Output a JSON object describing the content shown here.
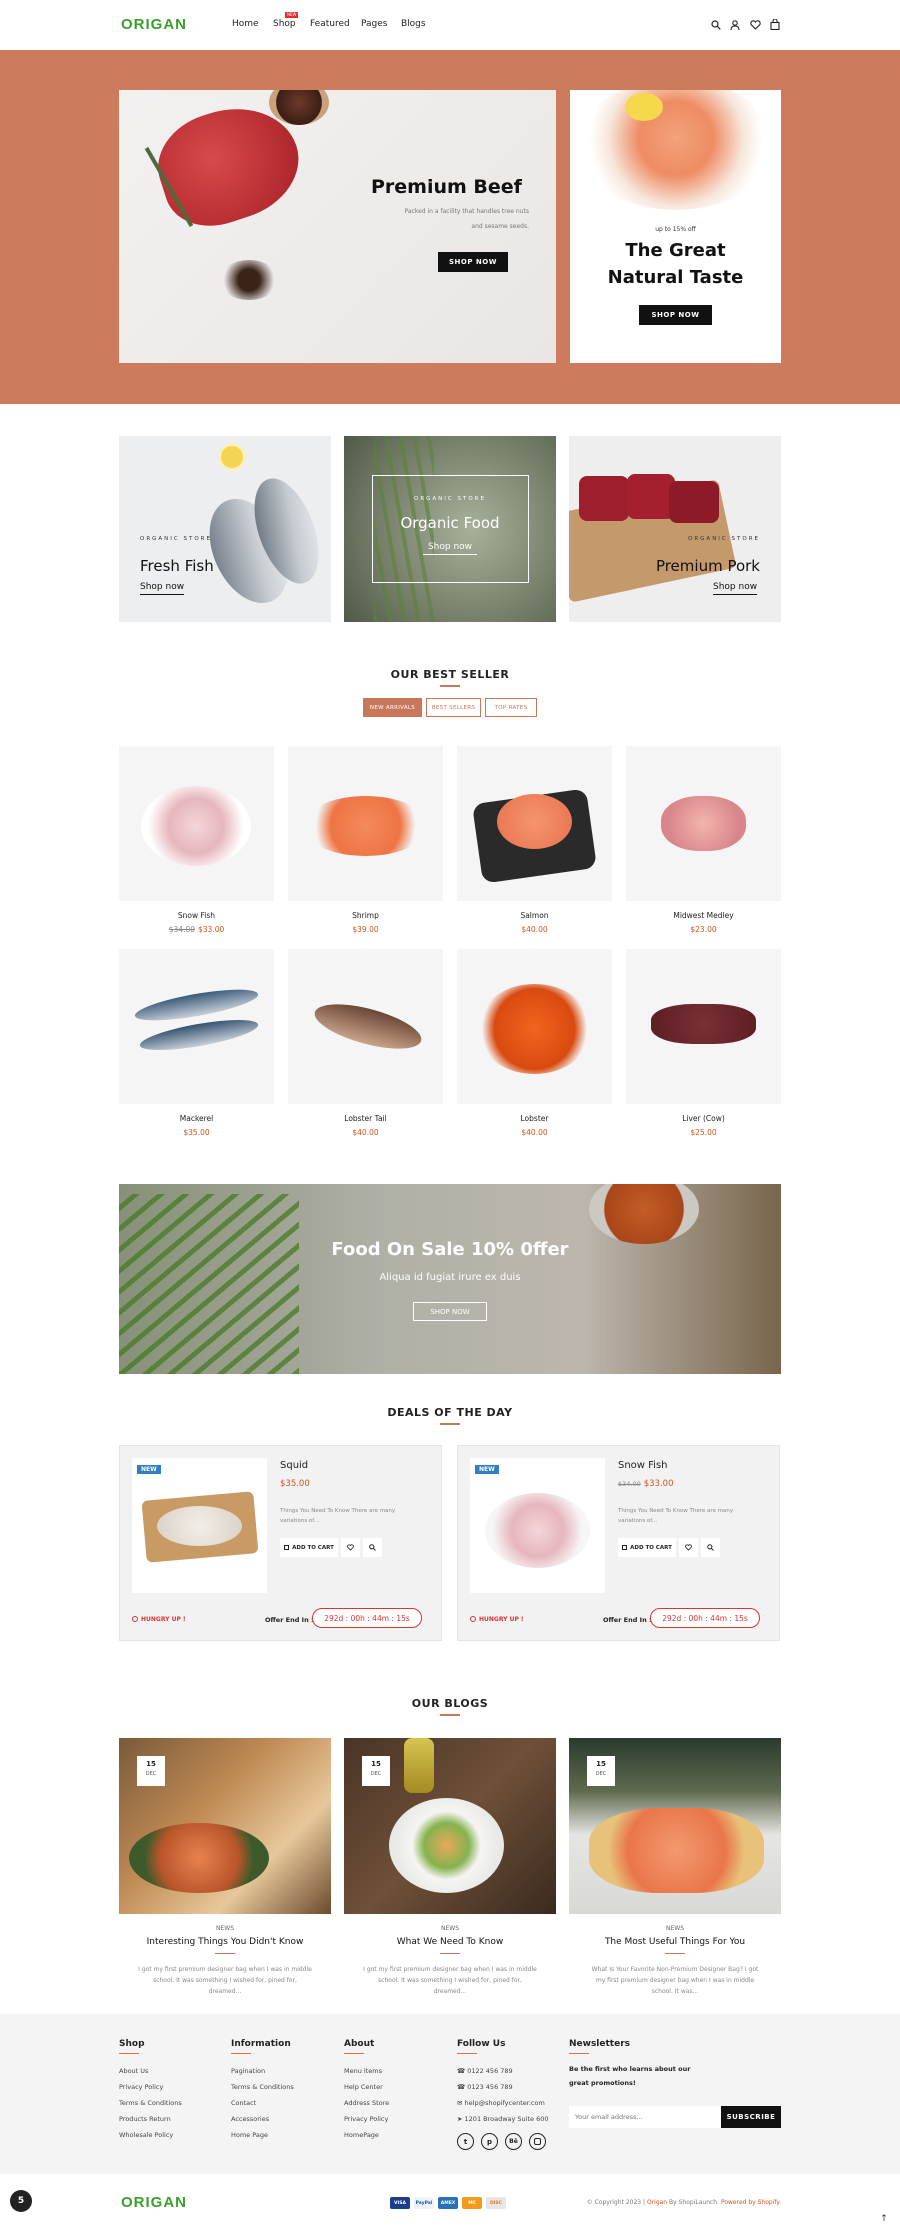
{
  "brand": {
    "logo": "ORIGAN",
    "accent": "#3aa02c",
    "terra": "#cc7c5c"
  },
  "nav": {
    "home": "Home",
    "shop": "Shop",
    "shop_badge": "NEW",
    "featured": "Featured",
    "pages": "Pages",
    "blogs": "Blogs"
  },
  "hero": {
    "main": {
      "title": "Premium Beef",
      "desc_line1": "Packed in a facility that handles tree nuts",
      "desc_line2": "and sesame seeds.",
      "button": "SHOP NOW"
    },
    "side": {
      "small": "up to 15% off",
      "title_line1": "The Great",
      "title_line2": "Natural Taste",
      "button": "SHOP NOW"
    }
  },
  "categories": [
    {
      "kicker": "ORGANIC STORE",
      "title": "Fresh Fish",
      "link": "Shop now"
    },
    {
      "kicker": "ORGANIC STORE",
      "title": "Organic Food",
      "link": "Shop now"
    },
    {
      "kicker": "ORGANIC STORE",
      "title": "Premium Pork",
      "link": "Shop now"
    }
  ],
  "bestseller": {
    "title": "OUR BEST SELLER",
    "tabs": [
      "NEW ARRIVALS",
      "BEST SELLERS",
      "TOP RATES"
    ],
    "products": [
      {
        "name": "Snow Fish",
        "old": "$34.00",
        "price": "$33.00"
      },
      {
        "name": "Shrimp",
        "price": "$39.00"
      },
      {
        "name": "Salmon",
        "price": "$40.00"
      },
      {
        "name": "Midwest Medley",
        "price": "$23.00"
      },
      {
        "name": "Mackerel",
        "price": "$35.00"
      },
      {
        "name": "Lobster Tail",
        "price": "$40.00"
      },
      {
        "name": "Lobster",
        "price": "$40.00"
      },
      {
        "name": "Liver (Cow)",
        "price": "$25.00"
      }
    ]
  },
  "sale": {
    "title": "Food On Sale 10% 0ffer",
    "subtitle": "Aliqua id fugiat irure ex duis",
    "button": "SHOP NOW"
  },
  "deals": {
    "title": "DEALS OF THE DAY",
    "items": [
      {
        "badge": "NEW",
        "name": "Squid",
        "price": "$35.00",
        "desc_line1": "Things You Need To Know There are many",
        "desc_line2": "variations of...",
        "add": "ADD TO CART",
        "hurry": "HUNGRY UP !",
        "offer": "Offer End In :",
        "timer": "292d : 00h : 44m : 15s"
      },
      {
        "badge": "NEW",
        "name": "Snow Fish",
        "old": "$34.00",
        "price": "$33.00",
        "desc_line1": "Things You Need To Know There are many",
        "desc_line2": "variations of...",
        "add": "ADD TO CART",
        "hurry": "HUNGRY UP !",
        "offer": "Offer End In :",
        "timer": "292d : 00h : 44m : 15s"
      }
    ]
  },
  "blogs": {
    "title": "OUR BLOGS",
    "items": [
      {
        "day": "15",
        "month": "DEC",
        "cat": "NEWS",
        "title": "Interesting Things You Didn't Know",
        "l1": "I got my first premium designer bag when I was in middle",
        "l2": "school. It was something I wished for, pined for,",
        "l3": "dreamed..."
      },
      {
        "day": "15",
        "month": "DEC",
        "cat": "NEWS",
        "title": "What We Need To Know",
        "l1": "I got my first premium designer bag when I was in middle",
        "l2": "school. It was something I wished for, pined for,",
        "l3": "dreamed..."
      },
      {
        "day": "15",
        "month": "DEC",
        "cat": "NEWS",
        "title": "The Most Useful Things For You",
        "l1": "What Is Your Favorite Non-Premium Designer Bag? I got",
        "l2": "my first premium designer bag when I was in middle",
        "l3": "school. It was..."
      }
    ]
  },
  "footer": {
    "shop": {
      "title": "Shop",
      "links": [
        "About Us",
        "Privacy Policy",
        "Terms & Conditions",
        "Products Return",
        "Wholesale Policy"
      ]
    },
    "info": {
      "title": "Information",
      "links": [
        "Pagination",
        "Terms & Conditions",
        "Contact",
        "Accessories",
        "Home Page"
      ]
    },
    "about": {
      "title": "About",
      "links": [
        "Menu items",
        "Help Center",
        "Address Store",
        "Privacy Policy",
        "HomePage"
      ]
    },
    "follow": {
      "title": "Follow Us",
      "phone1": "0122 456 789",
      "phone2": "0123 456 789",
      "email": "help@shopifycenter.com",
      "address": "1201 Broadway Suite 600"
    },
    "news": {
      "title": "Newsletters",
      "text1": "Be the first who learns about our",
      "text2": "great promotions!",
      "placeholder": "Your email address...",
      "button": "SUBSCRIBE"
    },
    "copyright_pre": "© Copyright 2023 |",
    "copyright_brand": "Origan",
    "copyright_mid": "By ShopiLaunch.",
    "copyright_post": "Powered by Shopify.",
    "payments": [
      "VISA",
      "PayPal",
      "AMEX",
      "MC",
      "DISC"
    ]
  }
}
